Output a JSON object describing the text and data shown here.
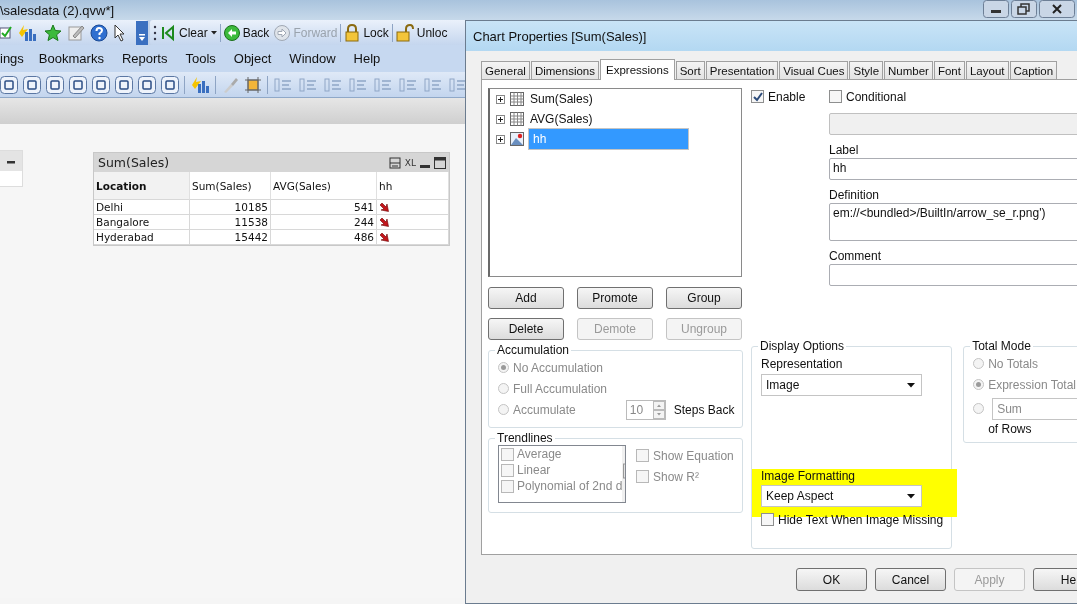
{
  "app": {
    "title": "\\salesdata (2).qvw*]",
    "toolbar": [
      {
        "label": "Clear",
        "kind": "clear",
        "disabled": false
      },
      {
        "label": "Back",
        "kind": "back",
        "disabled": false
      },
      {
        "label": "Forward",
        "kind": "forward",
        "disabled": true
      },
      {
        "label": "Lock",
        "kind": "lock",
        "disabled": false
      },
      {
        "label": "Unloc",
        "kind": "unlock",
        "disabled": false
      }
    ],
    "menu": [
      "ings",
      "Bookmarks",
      "Reports",
      "Tools",
      "Object",
      "Window",
      "Help"
    ]
  },
  "sheet": {
    "table": {
      "title": "Sum(Sales)",
      "caption_text": "XL",
      "columns": [
        "Location",
        "Sum(Sales)",
        "AVG(Sales)",
        "hh"
      ],
      "rows": [
        {
          "cells": [
            "Delhi",
            "10185",
            "541"
          ]
        },
        {
          "cells": [
            "Bangalore",
            "11538",
            "244"
          ]
        },
        {
          "cells": [
            "Hyderabad",
            "15442",
            "486"
          ]
        }
      ]
    }
  },
  "dialog": {
    "title": "Chart Properties [Sum(Sales)]",
    "tabs": [
      {
        "label": "General",
        "selected": false
      },
      {
        "label": "Dimensions",
        "selected": false
      },
      {
        "label": "Expressions",
        "selected": true
      },
      {
        "label": "Sort",
        "selected": false
      },
      {
        "label": "Presentation",
        "selected": false
      },
      {
        "label": "Visual Cues",
        "selected": false
      },
      {
        "label": "Style",
        "selected": false
      },
      {
        "label": "Number",
        "selected": false
      },
      {
        "label": "Font",
        "selected": false
      },
      {
        "label": "Layout",
        "selected": false
      },
      {
        "label": "Caption",
        "selected": false
      }
    ],
    "expressions": [
      {
        "label": "Sum(Sales)",
        "kind": "table",
        "selected": false
      },
      {
        "label": "AVG(Sales)",
        "kind": "table",
        "selected": false
      },
      {
        "label": "hh",
        "kind": "image",
        "selected": true
      }
    ],
    "enable": {
      "label": "Enable",
      "checked": true
    },
    "conditional": {
      "label": "Conditional",
      "checked": false
    },
    "fields": [
      {
        "label": "Label",
        "value": "hh"
      },
      {
        "label": "Definition",
        "value": "em://<bundled>/BuiltIn/arrow_se_r.png')"
      },
      {
        "label": "Comment"
      }
    ],
    "buttons": [
      {
        "label": "Add",
        "disabled": false
      },
      {
        "label": "Promote",
        "disabled": false
      },
      {
        "label": "Group",
        "disabled": false
      },
      {
        "label": "Delete",
        "disabled": false
      },
      {
        "label": "Demote",
        "disabled": true
      },
      {
        "label": "Ungroup",
        "disabled": true
      }
    ],
    "accumulation": {
      "title": "Accumulation",
      "disabled": true,
      "steps": "10",
      "steps_label": "Steps Back",
      "options": [
        {
          "label": "No Accumulation",
          "selected": true
        },
        {
          "label": "Full Accumulation",
          "selected": false
        },
        {
          "label": "Accumulate",
          "selected": false
        }
      ]
    },
    "trendlines": {
      "title": "Trendlines",
      "disabled": true,
      "items": [
        {
          "label": "Average",
          "checked": false
        },
        {
          "label": "Linear",
          "checked": false
        },
        {
          "label": "Polynomial of 2nd d",
          "checked": false
        }
      ],
      "options": [
        {
          "label": "Show Equation",
          "checked": false
        },
        {
          "label": "Show R²",
          "checked": false
        }
      ]
    },
    "display_options": {
      "title": "Display Options",
      "representation": {
        "label": "Representation",
        "value": "Image"
      },
      "image_formatting": {
        "label": "Image Formatting",
        "value": "Keep Aspect",
        "highlighted": true
      },
      "hide_text": {
        "label": "Hide Text When Image Missing",
        "checked": false
      }
    },
    "total_mode": {
      "title": "Total Mode",
      "disabled": true,
      "suffix": "of Rows",
      "options": [
        {
          "kind": "label",
          "label": "No Totals",
          "selected": false
        },
        {
          "kind": "label",
          "label": "Expression Total",
          "selected": true
        },
        {
          "kind": "select",
          "value": "Sum",
          "selected": false
        }
      ]
    },
    "footer_buttons": [
      {
        "label": "OK",
        "disabled": false
      },
      {
        "label": "Cancel",
        "disabled": false
      },
      {
        "label": "Apply",
        "disabled": true
      },
      {
        "label": "He",
        "disabled": false
      }
    ]
  }
}
